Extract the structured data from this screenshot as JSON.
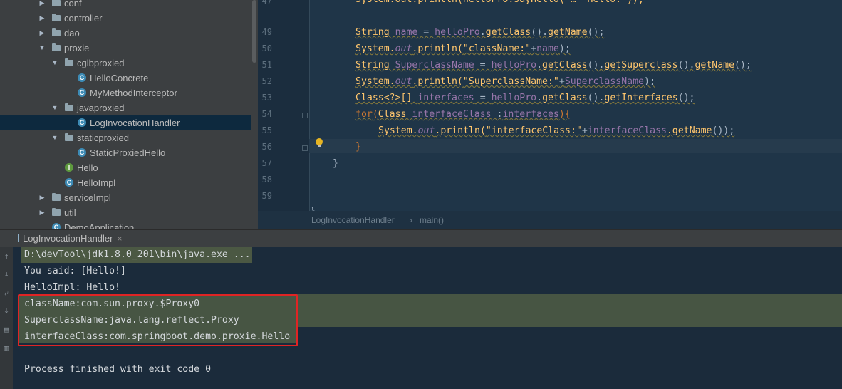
{
  "tree": {
    "items": [
      {
        "label": "conf",
        "kind": "folder",
        "expanded": false
      },
      {
        "label": "controller",
        "kind": "folder",
        "expanded": false
      },
      {
        "label": "dao",
        "kind": "folder",
        "expanded": false
      },
      {
        "label": "proxie",
        "kind": "folder",
        "expanded": true
      },
      {
        "label": "cglbproxied",
        "kind": "folder",
        "expanded": true
      },
      {
        "label": "HelloConcrete",
        "kind": "class"
      },
      {
        "label": "MyMethodInterceptor",
        "kind": "class"
      },
      {
        "label": "javaproxied",
        "kind": "folder",
        "expanded": true
      },
      {
        "label": "LogInvocationHandler",
        "kind": "class",
        "selected": true
      },
      {
        "label": "staticproxied",
        "kind": "folder",
        "expanded": true
      },
      {
        "label": "StaticProxiedHello",
        "kind": "class"
      },
      {
        "label": "Hello",
        "kind": "interface"
      },
      {
        "label": "HelloImpl",
        "kind": "class"
      },
      {
        "label": "serviceImpl",
        "kind": "folder",
        "expanded": false
      },
      {
        "label": "util",
        "kind": "folder",
        "expanded": false
      },
      {
        "label": "DemoApplication",
        "kind": "class"
      }
    ]
  },
  "editor": {
    "line_numbers": [
      "47",
      "49",
      "50",
      "51",
      "52",
      "53",
      "54",
      "55",
      "56",
      "57",
      "58",
      "59"
    ],
    "line47": "System.out.println(helloPro.sayHello(\"…\" Hello!\"));",
    "line49": {
      "t1": "String ",
      "v1": "name",
      " eq": " = ",
      "r1": "helloPro",
      ".d1": ".",
      "m1": "getClass",
      "p1": "().",
      "m2": "getName",
      "e": "();"
    },
    "line50": {
      "a": "System.",
      "b": "out",
      "c": ".println(",
      "s": "\"className:\"",
      "d": "+",
      "v": "name",
      "e": ");"
    },
    "line51": {
      "t": "String ",
      "v": "SuperclassName",
      " eq": " = ",
      "r": "helloPro",
      "d": ".",
      "m1": "getClass",
      "p1": "().",
      "m2": "getSuperclass",
      "p2": "().",
      "m3": "getName",
      "e": "();"
    },
    "line52": {
      "a": "System.",
      "b": "out",
      "c": ".println(",
      "s": "\"SuperclassName:\"",
      "d": "+",
      "v": "SuperclassName",
      "e": ");"
    },
    "line53": {
      "t": "Class<?>[] ",
      "v": "interfaces",
      " eq": " = ",
      "r": "helloPro",
      "d": ".",
      "m1": "getClass",
      "p1": "().",
      "m2": "getInterfaces",
      "e": "();"
    },
    "line54": {
      "k": "for",
      "o": "(",
      "t": "Class ",
      "v": "interfaceClass",
      " c": " :",
      "r": "interfaces",
      "e": "){"
    },
    "line55": {
      "a": "System.",
      "b": "out",
      "c": ".println(",
      "s": "\"interfaceClass:\"",
      "d": "+",
      "v": "interfaceClass",
      "m": ".getName",
      "e": "());"
    },
    "line56": "}",
    "line57": "}",
    "line60": "}"
  },
  "breadcrumb": {
    "class": "LogInvocationHandler",
    "sep": "›",
    "method": "main()"
  },
  "run": {
    "tab_label": "LogInvocationHandler",
    "close": "×"
  },
  "console": {
    "lines": [
      "D:\\devTool\\jdk1.8.0_201\\bin\\java.exe ...",
      "You said: [Hello!]",
      "HelloImpl: Hello!",
      "className:com.sun.proxy.$Proxy0",
      "SuperclassName:java.lang.reflect.Proxy",
      "interfaceClass:com.springboot.demo.proxie.Hello",
      "",
      "Process finished with exit code 0"
    ]
  },
  "colors": {
    "highlight_box": "#e02424",
    "keyword": "#cc7832",
    "method": "#ffc66d",
    "string": "#6a8759",
    "field": "#9876aa"
  }
}
